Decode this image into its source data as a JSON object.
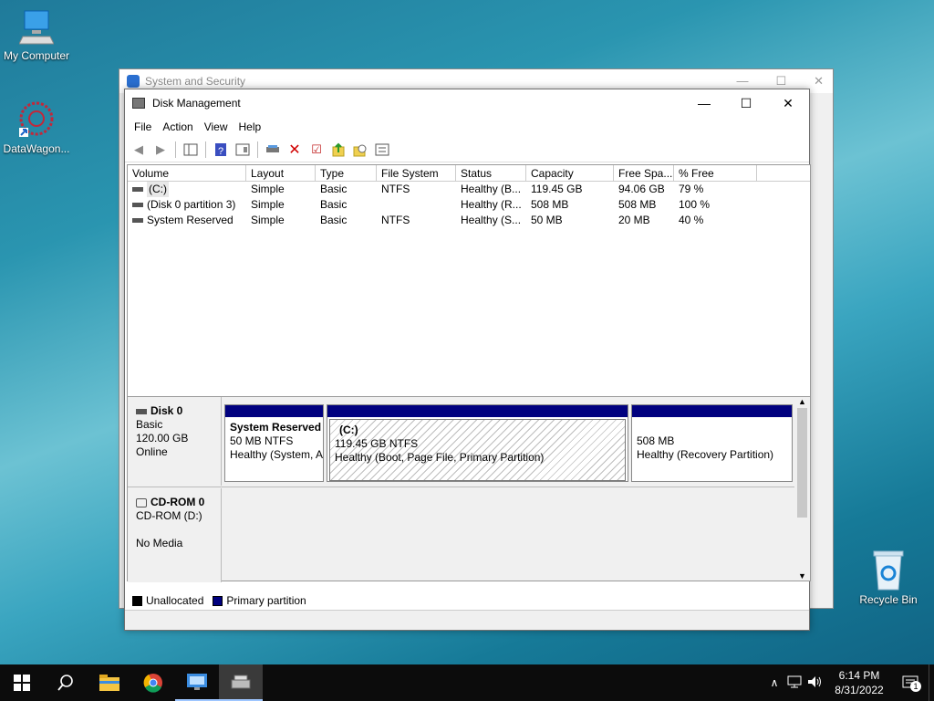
{
  "desktop": {
    "icons": [
      {
        "label": "My Computer",
        "icon": "computer-icon"
      },
      {
        "label": "DataWagon...",
        "icon": "datawagon-shortcut-icon"
      },
      {
        "label": "Recycle Bin",
        "icon": "recycle-bin-icon"
      }
    ]
  },
  "bg_window": {
    "title": "System and Security"
  },
  "window": {
    "title": "Disk Management",
    "menu": [
      "File",
      "Action",
      "View",
      "Help"
    ],
    "toolbar_icons": [
      "back-arrow-icon",
      "forward-arrow-icon",
      "show-hide-tree-icon",
      "help-icon",
      "properties-icon",
      "connect-disk-icon",
      "delete-icon",
      "checklist-icon",
      "rescan-icon",
      "search-icon",
      "settings-icon"
    ]
  },
  "volumes": {
    "columns": [
      "Volume",
      "Layout",
      "Type",
      "File System",
      "Status",
      "Capacity",
      "Free Spa...",
      "% Free"
    ],
    "rows": [
      [
        "(C:)",
        "Simple",
        "Basic",
        "NTFS",
        "Healthy (B...",
        "119.45 GB",
        "94.06 GB",
        "79 %"
      ],
      [
        "(Disk 0 partition 3)",
        "Simple",
        "Basic",
        "",
        "Healthy (R...",
        "508 MB",
        "508 MB",
        "100 %"
      ],
      [
        "System Reserved",
        "Simple",
        "Basic",
        "NTFS",
        "Healthy (S...",
        "50 MB",
        "20 MB",
        "40 %"
      ]
    ]
  },
  "disk0": {
    "name": "Disk 0",
    "type": "Basic",
    "size": "120.00 GB",
    "state": "Online",
    "partitions": [
      {
        "name": "System Reserved",
        "size": "50 MB NTFS",
        "status": "Healthy (System, A"
      },
      {
        "name": "(C:)",
        "size": "119.45 GB NTFS",
        "status": "Healthy (Boot, Page File, Primary Partition)"
      },
      {
        "name": "",
        "size": "508 MB",
        "status": "Healthy (Recovery Partition)"
      }
    ]
  },
  "cdrom0": {
    "name": "CD-ROM 0",
    "drive": "CD-ROM (D:)",
    "media": "No Media"
  },
  "legend": {
    "unallocated": "Unallocated",
    "primary": "Primary partition",
    "unallocated_color": "#000000",
    "primary_color": "#00007f"
  },
  "taskbar": {
    "items": [
      "start-icon",
      "search-icon",
      "file-explorer-icon",
      "chrome-icon",
      "remote-desktop-icon",
      "disk-management-icon"
    ],
    "time": "6:14 PM",
    "date": "8/31/2022",
    "notification_count": "1"
  }
}
